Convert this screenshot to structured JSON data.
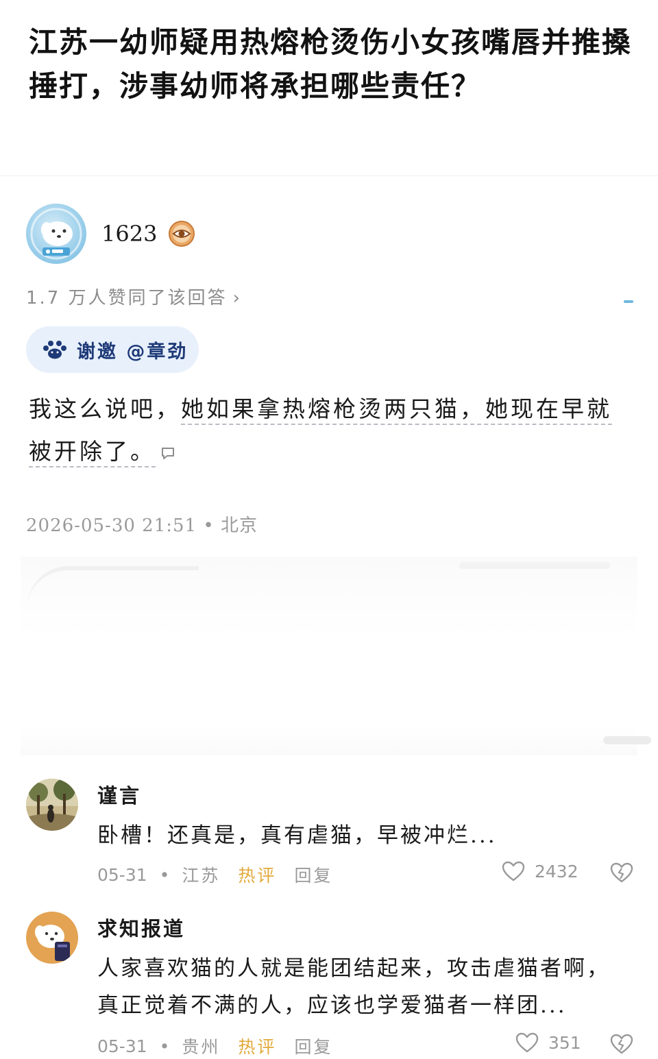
{
  "question": {
    "title": "江苏一幼师疑用热熔枪烫伤小女孩嘴唇并推搡捶打，涉事幼师将承担哪些责任？"
  },
  "answer": {
    "author": {
      "name": "1623",
      "avatar_icon": "dog-astronaut-avatar",
      "badge_icon": "eye-badge-icon"
    },
    "agree_text": "1.7 万人赞同了该回答",
    "agree_chevron": "›",
    "invite_text": "谢邀 @章劲",
    "invite_icon": "paw-icon",
    "body_part1": "我这么说吧，",
    "body_part2": "她如果拿热熔枪烫两只猫，她现在早就被开除了。",
    "timestamp": "2026-05-30 21:51",
    "location": "北京",
    "bullet": "•"
  },
  "comments": [
    {
      "name": "谨言",
      "text": "卧槽！还真是，真有虐猫，早被冲烂...",
      "date": "05-31",
      "location": "江苏",
      "hot_label": "热评",
      "reply_label": "回复",
      "likes": "2432",
      "bullet": "•"
    },
    {
      "name": "求知报道",
      "text": "人家喜欢猫的人就是能团结起来，攻击虐猫者啊，真正觉着不满的人，应该也学爱猫者一样团...",
      "date": "05-31",
      "location": "贵州",
      "hot_label": "热评",
      "reply_label": "回复",
      "likes": "351",
      "bullet": "•"
    }
  ],
  "colors": {
    "accent_blue": "#1e3a78",
    "pill_bg": "#e8f0fb",
    "hot_orange": "#e2a93b",
    "muted_gray": "#999999"
  }
}
